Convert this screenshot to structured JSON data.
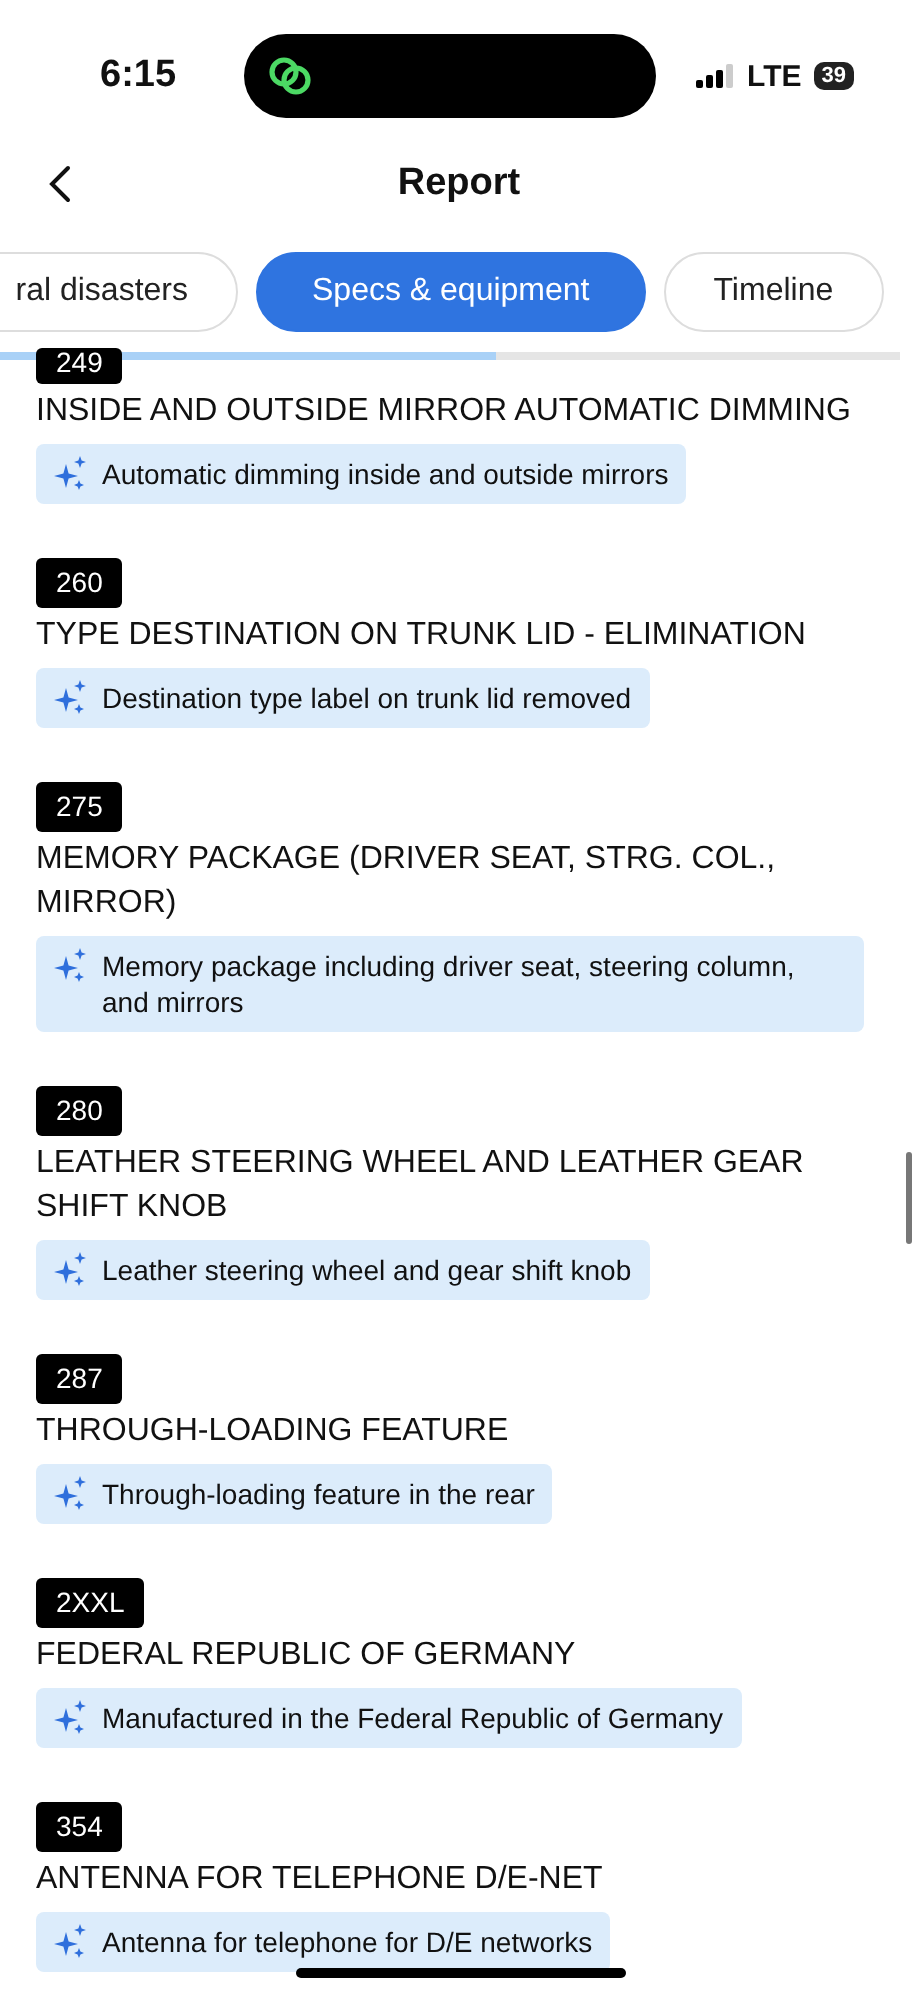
{
  "status_bar": {
    "time": "6:15",
    "network": "LTE",
    "battery": "39"
  },
  "header": {
    "title": "Report"
  },
  "tabs": [
    {
      "label": "ral disasters",
      "selected": false
    },
    {
      "label": "Specs & equipment",
      "selected": true
    },
    {
      "label": "Timeline",
      "selected": false
    }
  ],
  "tab_progress": {
    "level": 0.55
  },
  "items": [
    {
      "code": "249",
      "title": "INSIDE AND OUTSIDE MIRROR AUTOMATIC DIMMING",
      "summary": "Automatic dimming inside and outside mirrors"
    },
    {
      "code": "260",
      "title": "TYPE DESTINATION ON TRUNK LID - ELIMINATION",
      "summary": "Destination type label on trunk lid removed"
    },
    {
      "code": "275",
      "title": "MEMORY PACKAGE (DRIVER SEAT, STRG. COL., MIRROR)",
      "summary": "Memory package including driver seat, steering column, and mirrors"
    },
    {
      "code": "280",
      "title": "LEATHER STEERING WHEEL AND LEATHER GEAR SHIFT KNOB",
      "summary": "Leather steering wheel and gear shift knob"
    },
    {
      "code": "287",
      "title": "THROUGH-LOADING FEATURE",
      "summary": "Through-loading feature in the rear"
    },
    {
      "code": "2XXL",
      "title": "FEDERAL REPUBLIC OF GERMANY",
      "summary": "Manufactured in the Federal Republic of Germany"
    },
    {
      "code": "354",
      "title": "ANTENNA FOR TELEPHONE D/E-NET",
      "summary": "Antenna for telephone for D/E networks"
    }
  ]
}
